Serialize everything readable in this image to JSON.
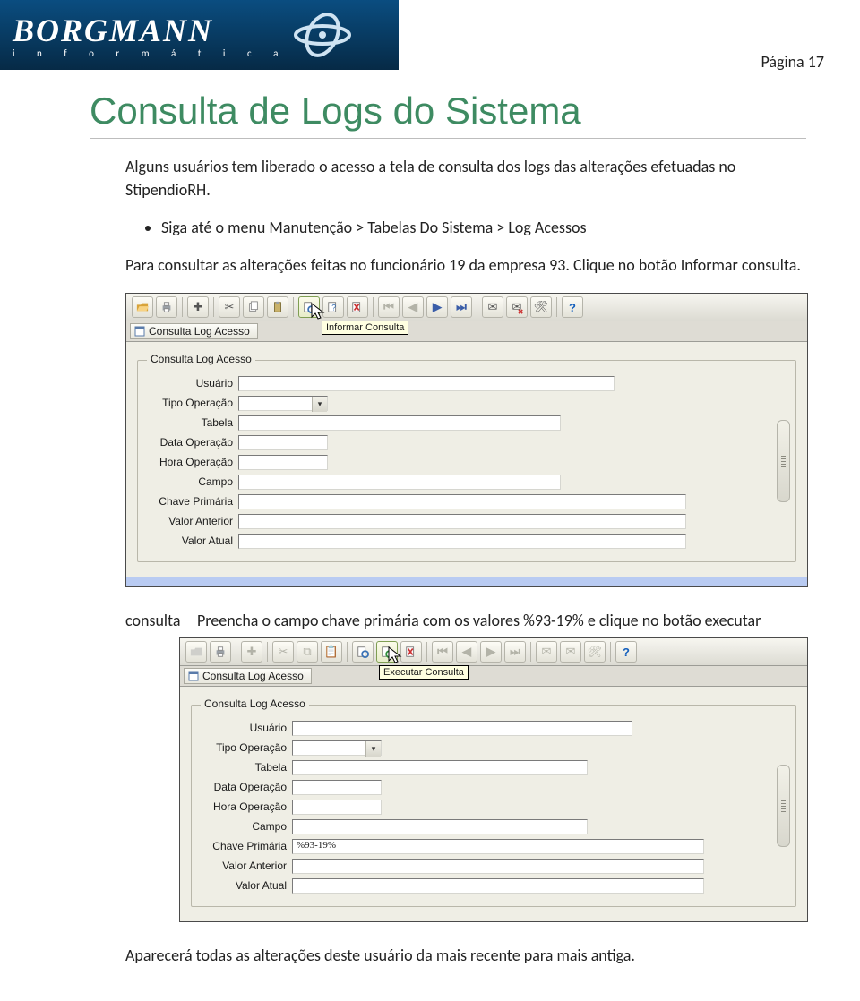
{
  "logo": {
    "name": "BORGMANN",
    "subtitle": "i n f o r m á t i c a"
  },
  "page_label": "Página 17",
  "title": "Consulta de Logs do Sistema",
  "intro": "Alguns usuários tem liberado o acesso a tela de consulta dos logs das alterações efetuadas no StipendioRH.",
  "bullet1": "Siga até o menu Manutenção > Tabelas Do Sistema > Log Acessos",
  "para2": "Para consultar as alterações feitas no funcionário 19 da empresa 93. Clique no botão Informar consulta.",
  "para3_label": "consulta",
  "para3_text": "Preencha o campo chave primária com os valores %93-19% e clique no botão executar",
  "footer": "Aparecerá todas as alterações deste usuário da mais recente para mais antiga.",
  "shot": {
    "window_title": "Consulta Log Acesso",
    "group_legend": "Consulta Log Acesso",
    "tooltip1": "Informar Consulta",
    "tooltip2": "Executar Consulta",
    "labels": {
      "usuario": "Usuário",
      "tipo": "Tipo Operação",
      "tabela": "Tabela",
      "data": "Data Operação",
      "hora": "Hora Operação",
      "campo": "Campo",
      "chave": "Chave Primária",
      "valant": "Valor Anterior",
      "valatu": "Valor Atual"
    },
    "chave_val": "%93-19%"
  },
  "icons": {
    "open": "open-icon",
    "print": "print-icon",
    "add": "plus-icon",
    "cut": "scissors-icon",
    "paste": "clipboard-icon",
    "copy": "copy-icon",
    "query1": "query-page-icon",
    "query2": "query-run-icon",
    "queryclear": "query-clear-icon",
    "first": "nav-first-icon",
    "prev": "nav-prev-icon",
    "next": "nav-next-icon",
    "last": "nav-last-icon",
    "mail1": "mail-icon",
    "mail2": "mail-del-icon",
    "tool": "tool-icon",
    "help": "help-icon"
  }
}
